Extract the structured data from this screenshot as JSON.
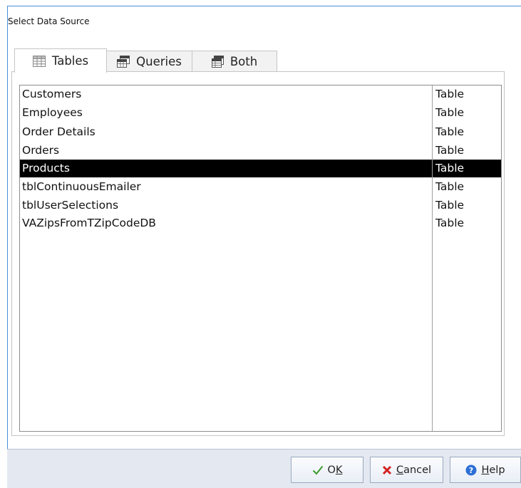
{
  "dialog": {
    "title": "Select Data Source"
  },
  "tabs": [
    {
      "label": "Tables",
      "icon": "table-icon",
      "active": true
    },
    {
      "label": "Queries",
      "icon": "query-icon",
      "active": false
    },
    {
      "label": "Both",
      "icon": "both-icon",
      "active": false
    }
  ],
  "list": {
    "rows": [
      {
        "name": "Customers",
        "type": "Table",
        "selected": false
      },
      {
        "name": "Employees",
        "type": "Table",
        "selected": false
      },
      {
        "name": "Order Details",
        "type": "Table",
        "selected": false
      },
      {
        "name": "Orders",
        "type": "Table",
        "selected": false
      },
      {
        "name": "Products",
        "type": "Table",
        "selected": true
      },
      {
        "name": "tblContinuousEmailer",
        "type": "Table",
        "selected": false
      },
      {
        "name": "tblUserSelections",
        "type": "Table",
        "selected": false
      },
      {
        "name": "VAZipsFromTZipCodeDB",
        "type": "Table",
        "selected": false
      }
    ]
  },
  "buttons": {
    "ok": {
      "accel": "K",
      "label_prefix": "O",
      "label_suffix": "",
      "icon": "checkmark-icon"
    },
    "cancel": {
      "accel": "C",
      "label_prefix": "",
      "label_suffix": "ancel",
      "icon": "x-icon"
    },
    "help": {
      "accel": "H",
      "label_prefix": "",
      "label_suffix": "elp",
      "icon": "help-icon"
    }
  },
  "colors": {
    "selection_bg": "#000000",
    "selection_fg": "#ffffff",
    "footer_bg": "#e4e9f1",
    "ok_icon": "#3b9b2f",
    "cancel_icon": "#d42020",
    "help_icon": "#2c6fd6"
  }
}
